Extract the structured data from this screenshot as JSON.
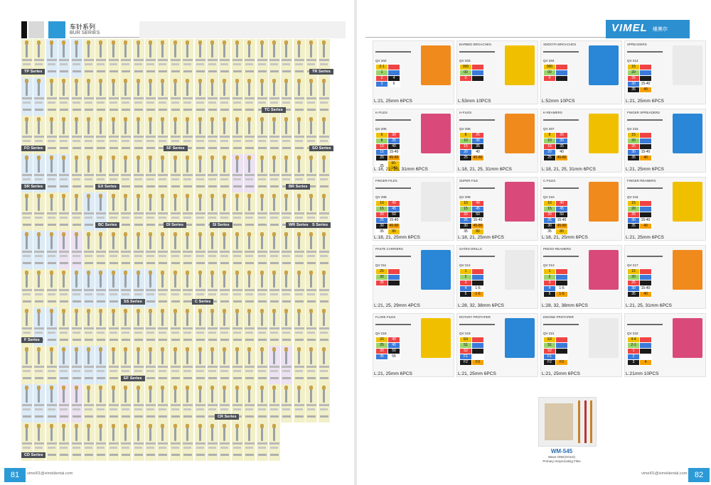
{
  "left_page": {
    "title_cn": "车针系列",
    "title_en": "BUR SERIES",
    "page_number": "81",
    "email": "vimel01@vimeldental.com",
    "series_labels": [
      "TP Series",
      "TR Series",
      "TC Series",
      "FO Series",
      "SF Series",
      "SO Series",
      "SR Series",
      "EX Series",
      "BR Series",
      "BC Series",
      "DI Series",
      "SI Series",
      "WR Series",
      "S Series",
      "SS Series",
      "C Series",
      "F Series",
      "EF Series",
      "CR Series",
      "CD Series"
    ],
    "bur_codes_sample": [
      "TF-11",
      "TF-12",
      "TF-13",
      "TR-11",
      "TC-11",
      "SF-11",
      "SO-11",
      "EX-11",
      "BR-11",
      "DI-11",
      "SI-11",
      "SS-11",
      "EF-11",
      "CR-11",
      "CD-11"
    ]
  },
  "right_page": {
    "brand": "VIMEL",
    "brand_cn": "维美尔",
    "page_number": "82",
    "email": "vimel01@vimeldental.com",
    "colors": {
      "accent": "#2c8fd0"
    },
    "products": [
      {
        "name": "",
        "qv": "QV 202",
        "rows": [
          [
            "2-1",
            ""
          ],
          [
            "1",
            ""
          ],
          [
            "2",
            "4"
          ],
          [
            "3",
            "6"
          ]
        ],
        "caption": "L:21, 25mm 6PCS"
      },
      {
        "name": "BARBED BROACHES",
        "qv": "QV 203",
        "rows": [
          [
            "000",
            ""
          ],
          [
            "00",
            ""
          ],
          [
            "0",
            ""
          ]
        ],
        "caption": "L:53mm 10PCS"
      },
      {
        "name": "SMOOTH BROACHES",
        "qv": "QV 204",
        "rows": [
          [
            "000",
            ""
          ],
          [
            "00",
            ""
          ],
          [
            "0",
            ""
          ]
        ],
        "caption": "L:52mm 10PCS"
      },
      {
        "name": "SPREADERS",
        "qv": "QV 214",
        "rows": [
          [
            "15",
            ""
          ],
          [
            "20",
            ""
          ],
          [
            "25",
            ""
          ],
          [
            "30",
            "15-40"
          ],
          [
            "35",
            "40"
          ]
        ],
        "caption": "L:21, 25mm 6PCS"
      },
      {
        "name": "K-FILES",
        "qv": "QV 205",
        "rows": [
          [
            "6",
            "30"
          ],
          [
            "8",
            "35"
          ],
          [
            "10",
            "40"
          ],
          [
            "15",
            "15-40"
          ],
          [
            "20",
            "45-80"
          ],
          [
            "25",
            "90-140"
          ]
        ],
        "caption": "L:18, 21, 25, 31mm 6PCS"
      },
      {
        "name": "H-FILES",
        "qv": "QV 206",
        "rows": [
          [
            "8",
            "25"
          ],
          [
            "10",
            "30"
          ],
          [
            "15",
            "35"
          ],
          [
            "20",
            "40"
          ],
          [
            "25",
            "45-80"
          ]
        ],
        "caption": "L:18, 21, 25, 31mm 6PCS"
      },
      {
        "name": "K-REAMERS",
        "qv": "QV 207",
        "rows": [
          [
            "8",
            "25"
          ],
          [
            "10",
            "30"
          ],
          [
            "15",
            "35"
          ],
          [
            "20",
            "40"
          ],
          [
            "25",
            "45-80"
          ]
        ],
        "caption": "L:18, 21, 25, 31mm 6PCS"
      },
      {
        "name": "FINGER SPREADERS",
        "qv": "QV 215",
        "rows": [
          [
            "15",
            ""
          ],
          [
            "20",
            ""
          ],
          [
            "25",
            ""
          ],
          [
            "30",
            "15-40"
          ],
          [
            "35",
            "40"
          ]
        ],
        "caption": "L:21, 25mm 6PCS"
      },
      {
        "name": "FINGER FILES",
        "qv": "QV 208",
        "rows": [
          [
            "10",
            "40"
          ],
          [
            "15",
            "45"
          ],
          [
            "20",
            "50"
          ],
          [
            "25",
            "15-40"
          ],
          [
            "30",
            "45-80"
          ],
          [
            "35",
            "80"
          ]
        ],
        "caption": "L:18, 21, 25mm 6PCS"
      },
      {
        "name": "SUPER FILE",
        "qv": "QV 209",
        "rows": [
          [
            "10",
            "40"
          ],
          [
            "15",
            "45"
          ],
          [
            "20",
            "50"
          ],
          [
            "25",
            "15-40"
          ],
          [
            "30",
            "45-80"
          ],
          [
            "35",
            "80"
          ]
        ],
        "caption": "L:18, 21, 25mm 6PCS"
      },
      {
        "name": "C-FILES",
        "qv": "QV 210",
        "rows": [
          [
            "10",
            "40"
          ],
          [
            "15",
            "45"
          ],
          [
            "20",
            "50"
          ],
          [
            "25",
            "15-40"
          ],
          [
            "30",
            "45-80"
          ],
          [
            "35",
            "80"
          ]
        ],
        "caption": "L:18, 21, 25mm 6PCS"
      },
      {
        "name": "FINGER REAMERS",
        "qv": "QV 216",
        "rows": [
          [
            "15",
            ""
          ],
          [
            "20",
            ""
          ],
          [
            "25",
            ""
          ],
          [
            "30",
            "15-40"
          ],
          [
            "35",
            "40"
          ]
        ],
        "caption": "L:21, 25mm 6PCS"
      },
      {
        "name": "PASTE CARRIERS",
        "qv": "QV 211",
        "rows": [
          [
            "25",
            ""
          ],
          [
            "30",
            ""
          ],
          [
            "35",
            ""
          ]
        ],
        "caption": "L:21, 25, 29mm 4PCS"
      },
      {
        "name": "GATES DRILLS",
        "qv": "QV 212",
        "rows": [
          [
            "1",
            ""
          ],
          [
            "2",
            ""
          ],
          [
            "3",
            ""
          ],
          [
            "4",
            "1-6"
          ],
          [
            "5",
            "1-6"
          ]
        ],
        "caption": "L:28, 32, 38mm 6PCS"
      },
      {
        "name": "PEESO REAMERS",
        "qv": "QV 213",
        "rows": [
          [
            "1",
            ""
          ],
          [
            "2",
            ""
          ],
          [
            "3",
            ""
          ],
          [
            "4",
            "1-6"
          ],
          [
            "5",
            "1-6"
          ]
        ],
        "caption": "L:28, 32, 38mm 6PCS"
      },
      {
        "name": "",
        "qv": "QV 217",
        "rows": [
          [
            "15",
            ""
          ],
          [
            "20",
            ""
          ],
          [
            "25",
            ""
          ],
          [
            "30",
            "15-40"
          ],
          [
            "35",
            "40"
          ]
        ],
        "caption": "L:21, 25, 31mm 6PCS"
      },
      {
        "name": "FLARE FILES",
        "qv": "QV 218",
        "rows": [
          [
            "20",
            "40"
          ],
          [
            "25",
            "45"
          ],
          [
            "30",
            "50"
          ],
          [
            "35",
            "55"
          ]
        ],
        "caption": "L:21, 25mm 6PCS"
      },
      {
        "name": "ROTARY PROTAPER",
        "qv": "QV 219",
        "rows": [
          [
            "SX",
            ""
          ],
          [
            "S1",
            ""
          ],
          [
            "S2",
            ""
          ],
          [
            "F1",
            ""
          ],
          [
            "F2",
            "F3"
          ]
        ],
        "caption": "L:21, 25mm 6PCS"
      },
      {
        "name": "ENGINE PROTAPER",
        "qv": "QV 221",
        "rows": [
          [
            "SX",
            ""
          ],
          [
            "S1",
            ""
          ],
          [
            "S2",
            ""
          ],
          [
            "F1",
            ""
          ],
          [
            "F2",
            "F3"
          ]
        ],
        "caption": "L:21, 25mm 6PCS"
      },
      {
        "name": "",
        "qv": "QV 222",
        "rows": [
          [
            "4-4",
            ""
          ],
          [
            "2-1",
            ""
          ],
          [
            "1",
            ""
          ],
          [
            "2",
            ""
          ],
          [
            "3",
            "4"
          ]
        ],
        "caption": "L:21mm 10PCS"
      }
    ],
    "featured": {
      "model": "WM-545",
      "line1": "Wave ONE(GOLD)",
      "line2": "Primary reciprocating Files"
    }
  }
}
